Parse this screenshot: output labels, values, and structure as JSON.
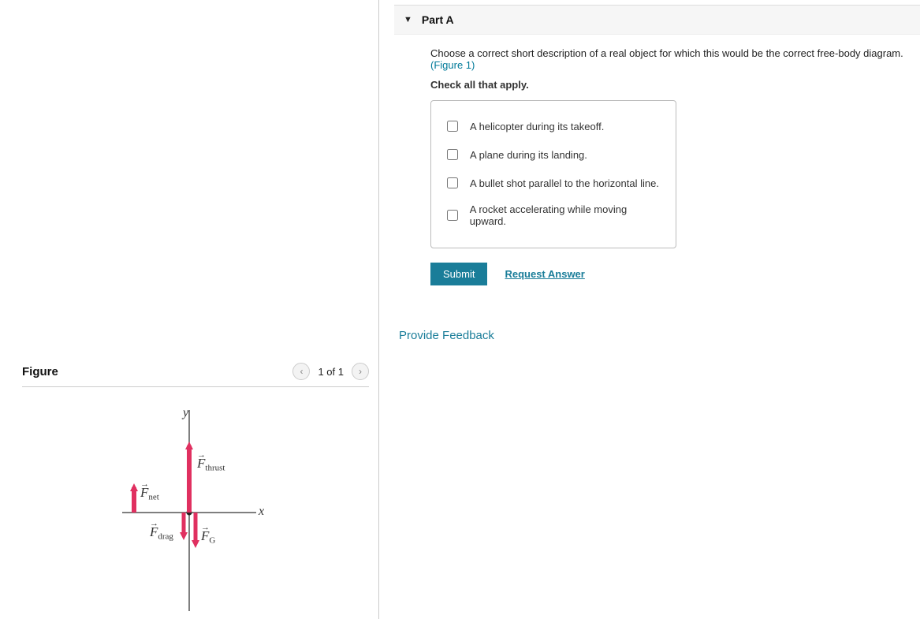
{
  "part": {
    "title": "Part A",
    "question": "Choose a correct short description of a real object for which this would be the correct free-body diagram.",
    "figure_ref": "(Figure 1)",
    "check_all": "Check all that apply.",
    "options": [
      "A helicopter during its takeoff.",
      "A plane during its landing.",
      "A bullet shot parallel to the horizontal line.",
      "A rocket accelerating while moving upward."
    ],
    "submit_label": "Submit",
    "request_answer_label": "Request Answer"
  },
  "feedback_link": "Provide Feedback",
  "figure": {
    "title": "Figure",
    "page": "1 of 1",
    "labels": {
      "y": "y",
      "x": "x",
      "F_thrust_base": "F",
      "F_thrust_sub": "thrust",
      "F_net_base": "F",
      "F_net_sub": "net",
      "F_drag_base": "F",
      "F_drag_sub": "drag",
      "F_G_base": "F",
      "F_G_sub": "G"
    }
  },
  "chart_data": {
    "type": "diagram",
    "description": "Free-body diagram with vertical y-axis and horizontal x-axis. Three force vectors originate near the origin: F_thrust points upward (large), F_drag points downward (small), F_G points downward (medium). A separate F_net vector is shown to the left pointing upward (small).",
    "vectors": [
      {
        "name": "F_thrust",
        "direction": "up",
        "relative_length": 1.0
      },
      {
        "name": "F_drag",
        "direction": "down",
        "relative_length": 0.35
      },
      {
        "name": "F_G",
        "direction": "down",
        "relative_length": 0.45
      },
      {
        "name": "F_net",
        "direction": "up",
        "relative_length": 0.35,
        "offset": "left"
      }
    ],
    "axes": [
      "x",
      "y"
    ]
  }
}
